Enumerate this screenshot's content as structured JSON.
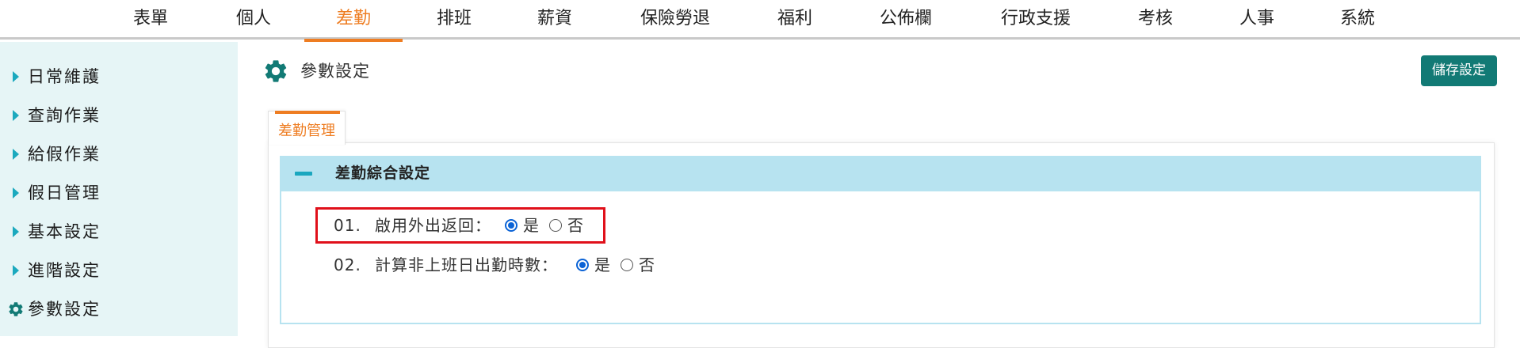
{
  "topnav": {
    "items": [
      {
        "label": "表單"
      },
      {
        "label": "個人"
      },
      {
        "label": "差勤"
      },
      {
        "label": "排班"
      },
      {
        "label": "薪資"
      },
      {
        "label": "保險勞退"
      },
      {
        "label": "福利"
      },
      {
        "label": "公佈欄"
      },
      {
        "label": "行政支援"
      },
      {
        "label": "考核"
      },
      {
        "label": "人事"
      },
      {
        "label": "系統"
      }
    ],
    "active_label": "差勤",
    "accent_color": "#ee7d22"
  },
  "sidebar": {
    "items": [
      {
        "label": "日常維護",
        "icon": "caret-right-icon"
      },
      {
        "label": "查詢作業",
        "icon": "caret-right-icon"
      },
      {
        "label": "給假作業",
        "icon": "caret-right-icon"
      },
      {
        "label": "假日管理",
        "icon": "caret-right-icon"
      },
      {
        "label": "基本設定",
        "icon": "caret-right-icon"
      },
      {
        "label": "進階設定",
        "icon": "caret-right-icon"
      },
      {
        "label": "參數設定",
        "icon": "gear-icon"
      }
    ],
    "active_label": "參數設定"
  },
  "page": {
    "title": "參數設定",
    "title_icon": "gear-icon",
    "save_label": "儲存設定",
    "save_color": "#127a75"
  },
  "tabs": [
    {
      "label": "差勤管理",
      "active": true
    }
  ],
  "section": {
    "title": "差勤綜合設定",
    "header_color": "#b7e3f0",
    "collapse_icon": "minus-icon",
    "settings": [
      {
        "number": "01.",
        "label": "啟用外出返回：",
        "options": [
          "是",
          "否"
        ],
        "selected": "是",
        "highlighted": true
      },
      {
        "number": "02.",
        "label": "計算非上班日出勤時數：",
        "options": [
          "是",
          "否"
        ],
        "selected": "是",
        "highlighted": false
      }
    ]
  }
}
